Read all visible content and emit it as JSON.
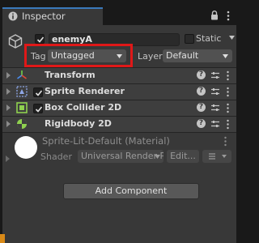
{
  "tab": {
    "title": "Inspector"
  },
  "header": {
    "object_name": "enemyA",
    "active": true,
    "static_label": "Static",
    "static_checked": false,
    "tag_label": "Tag",
    "tag_value": "Untagged",
    "layer_label": "Layer",
    "layer_value": "Default"
  },
  "components": [
    {
      "name": "Transform",
      "icon": "transform-icon",
      "has_checkbox": false
    },
    {
      "name": "Sprite Renderer",
      "icon": "sprite-renderer-icon",
      "has_checkbox": true
    },
    {
      "name": "Box Collider 2D",
      "icon": "box-collider-2d-icon",
      "has_checkbox": true
    },
    {
      "name": "Rigidbody 2D",
      "icon": "rigidbody-2d-icon",
      "has_checkbox": false
    }
  ],
  "material": {
    "name": "Sprite-Lit-Default (Material)",
    "shader_label": "Shader",
    "shader_value": "Universal Render P",
    "edit_label": "Edit..."
  },
  "add_component_label": "Add Component",
  "colors": {
    "accent": "#3a79bb",
    "highlight": "#e01818",
    "panel": "#383838"
  }
}
